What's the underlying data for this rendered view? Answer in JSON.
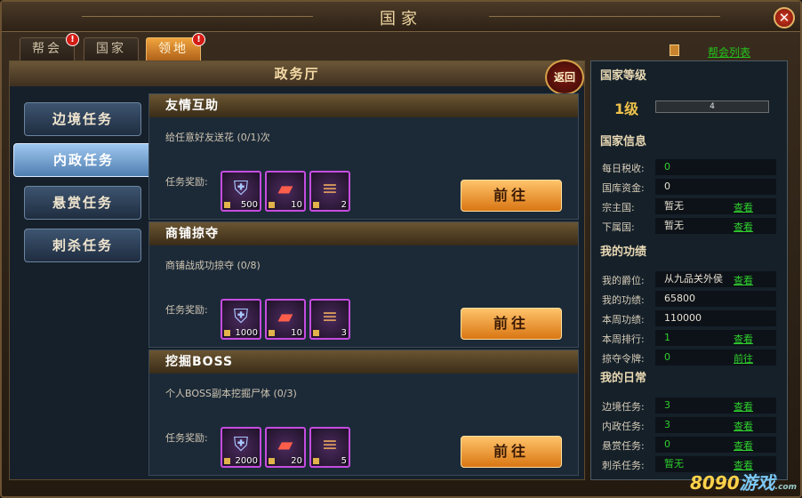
{
  "window": {
    "title": "国家",
    "close_glyph": "✕"
  },
  "tabs": [
    {
      "label": "帮会",
      "alert": true
    },
    {
      "label": "国家",
      "alert": false
    },
    {
      "label": "领地",
      "alert": true
    }
  ],
  "alert_glyph": "!",
  "guild_list_link": "帮会列表",
  "hall": {
    "title": "政务厅",
    "back_label": "返回"
  },
  "sidebar": [
    {
      "label": "边境任务"
    },
    {
      "label": "内政任务"
    },
    {
      "label": "悬赏任务"
    },
    {
      "label": "刺杀任务"
    }
  ],
  "tasks": [
    {
      "title": "友情互助",
      "desc": "给任意好友送花 (0/1)次",
      "reward_label": "任务奖励:",
      "rewards": [
        {
          "icon": "shield-icon",
          "count": "500"
        },
        {
          "icon": "merit-scroll-icon",
          "count": "10"
        },
        {
          "icon": "wood-log-icon",
          "count": "2"
        }
      ],
      "button": "前往"
    },
    {
      "title": "商铺掠夺",
      "desc": "商铺战成功掠夺 (0/8)",
      "reward_label": "任务奖励:",
      "rewards": [
        {
          "icon": "shield-icon",
          "count": "1000"
        },
        {
          "icon": "merit-scroll-icon",
          "count": "10"
        },
        {
          "icon": "wood-log-icon",
          "count": "3"
        }
      ],
      "button": "前往"
    },
    {
      "title": "挖掘BOSS",
      "desc": "个人BOSS副本挖掘尸体 (0/3)",
      "reward_label": "任务奖励:",
      "rewards": [
        {
          "icon": "shield-icon",
          "count": "2000"
        },
        {
          "icon": "merit-scroll-icon",
          "count": "20"
        },
        {
          "icon": "wood-log-icon",
          "count": "5"
        }
      ],
      "button": "前往"
    }
  ],
  "country_level": {
    "heading": "国家等级",
    "level": "1级",
    "bar_value": "4"
  },
  "country_info": {
    "heading": "国家信息",
    "rows": [
      {
        "key": "每日税收:",
        "value": "0",
        "link": ""
      },
      {
        "key": "国库资金:",
        "value": "0",
        "link": ""
      },
      {
        "key": "宗主国:",
        "value": "暂无",
        "link": "查看"
      },
      {
        "key": "下属国:",
        "value": "暂无",
        "link": "查看"
      }
    ]
  },
  "merit": {
    "heading": "我的功绩",
    "rows": [
      {
        "key": "我的爵位:",
        "value": "从九品关外侯",
        "link": "查看"
      },
      {
        "key": "我的功绩:",
        "value": "65800",
        "link": ""
      },
      {
        "key": "本周功绩:",
        "value": "110000",
        "link": ""
      },
      {
        "key": "本周排行:",
        "value": "1",
        "link": "查看"
      },
      {
        "key": "掠夺令牌:",
        "value": "0",
        "link": "前往"
      }
    ]
  },
  "daily": {
    "heading": "我的日常",
    "rows": [
      {
        "key": "边境任务:",
        "value": "3",
        "link": "查看"
      },
      {
        "key": "内政任务:",
        "value": "3",
        "link": "查看"
      },
      {
        "key": "悬赏任务:",
        "value": "0",
        "link": "查看"
      },
      {
        "key": "刺杀任务:",
        "value": "暂无",
        "link": "查看"
      }
    ]
  },
  "watermark": {
    "prefix": "8090",
    "suffix": "游戏",
    "domain": ".com"
  },
  "colors": {
    "accent": "#f0a43e",
    "link": "#2fd02e",
    "reward_border": "#c54de0"
  }
}
